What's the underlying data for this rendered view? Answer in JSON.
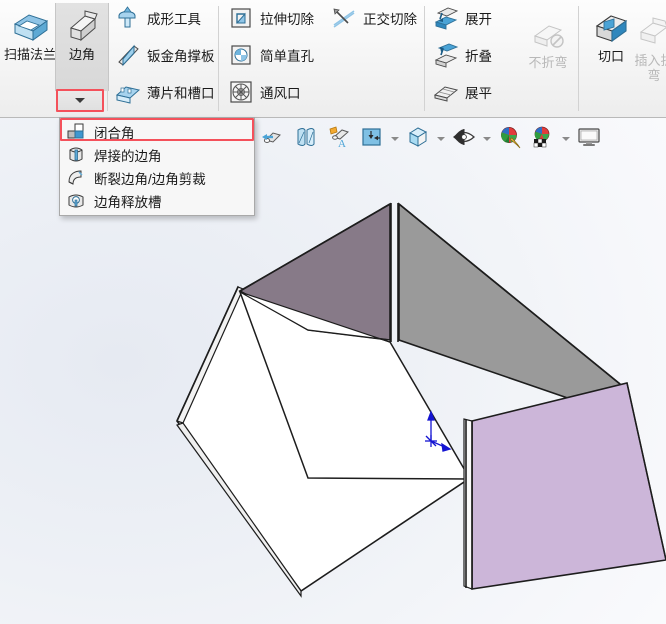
{
  "ribbon": {
    "groups": [
      {
        "name": "flange-group",
        "buttons": [
          {
            "label": "扫描法兰",
            "icon": "swept-flange-icon",
            "style": "big",
            "enabled": true
          },
          {
            "label": "边角",
            "icon": "corner-icon",
            "style": "big",
            "enabled": true,
            "active": true,
            "has_dropdown": true
          }
        ]
      },
      {
        "name": "forming-group",
        "buttons": [
          {
            "label": "成形工具",
            "icon": "forming-tool-icon",
            "style": "small",
            "enabled": true
          },
          {
            "label": "钣金角撑板",
            "icon": "sheet-metal-gusset-icon",
            "style": "small",
            "enabled": true
          },
          {
            "label": "薄片和槽口",
            "icon": "tab-and-slot-icon",
            "style": "small",
            "enabled": true
          }
        ]
      },
      {
        "name": "cut-group",
        "buttons": [
          {
            "label": "拉伸切除",
            "icon": "extruded-cut-icon",
            "style": "small",
            "enabled": true
          },
          {
            "label": "简单直孔",
            "icon": "simple-hole-icon",
            "style": "small",
            "enabled": true
          },
          {
            "label": "通风口",
            "icon": "vent-icon",
            "style": "small",
            "enabled": true
          },
          {
            "label": "正交切除",
            "icon": "normal-cut-icon",
            "style": "small",
            "enabled": true
          }
        ]
      },
      {
        "name": "flatten-group",
        "buttons": [
          {
            "label": "展开",
            "icon": "unfold-icon",
            "style": "small",
            "enabled": true
          },
          {
            "label": "折叠",
            "icon": "fold-icon",
            "style": "small",
            "enabled": true
          },
          {
            "label": "展平",
            "icon": "flatten-icon",
            "style": "small",
            "enabled": true
          },
          {
            "label": "不折弯",
            "icon": "no-bends-icon",
            "style": "big",
            "enabled": false
          }
        ]
      },
      {
        "name": "rip-group",
        "buttons": [
          {
            "label": "切口",
            "icon": "rip-icon",
            "style": "big",
            "enabled": true
          },
          {
            "label": "插入折弯",
            "icon": "insert-bends-icon",
            "style": "big",
            "enabled": false
          }
        ]
      }
    ]
  },
  "corner_dropdown": {
    "open": true,
    "items": [
      {
        "label": "闭合角",
        "icon": "closed-corner-icon",
        "highlighted": true
      },
      {
        "label": "焊接的边角",
        "icon": "welded-corner-icon",
        "highlighted": false
      },
      {
        "label": "断裂边角/边角剪裁",
        "icon": "break-corner-icon",
        "highlighted": false
      },
      {
        "label": "边角释放槽",
        "icon": "corner-relief-icon",
        "highlighted": false
      }
    ]
  },
  "view_toolbar": {
    "buttons": [
      {
        "icon": "zoom-to-fit-icon",
        "caret": false
      },
      {
        "icon": "section-view-icon",
        "caret": false
      },
      {
        "icon": "view-orientation-text-icon",
        "caret": false
      },
      {
        "icon": "view-orientation-icon",
        "caret": true
      },
      {
        "icon": "display-style-icon",
        "caret": true
      },
      {
        "icon": "hide-show-items-icon",
        "caret": true
      },
      {
        "icon": "edit-appearance-icon",
        "caret": false
      },
      {
        "icon": "apply-scene-icon",
        "caret": true
      },
      {
        "icon": "view-settings-icon",
        "caret": false
      }
    ]
  },
  "model": {
    "name": "sheet-metal-tapered-box",
    "faces": [
      {
        "name": "back-left-wall",
        "color": "#877a88"
      },
      {
        "name": "back-right-wall",
        "color": "#9a9a9a"
      },
      {
        "name": "front-right-wall",
        "color": "#ccb6d9"
      },
      {
        "name": "front-left-wall",
        "color": "#ffffff"
      },
      {
        "name": "bottom-inner-face",
        "color": "#ffffff"
      }
    ],
    "origin_marker_color": "#1414d2"
  },
  "colors": {
    "highlight_red": "#f4515b",
    "ribbon_bg": "#f2f2f2",
    "menu_bg": "#f7f7f7",
    "viewport_bg": "#eef1f6"
  }
}
